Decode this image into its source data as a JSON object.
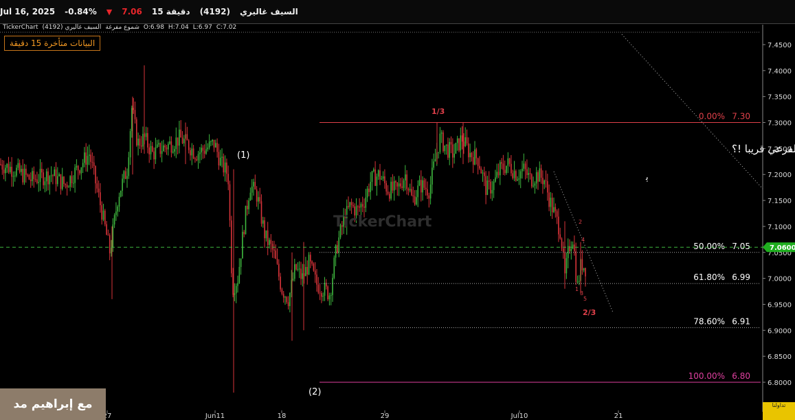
{
  "header": {
    "symbol_name": "السيف غاليري",
    "symbol_code": "(4192)",
    "interval": "15 دقيقة",
    "price": "7.06",
    "change_pct": "-0.84%",
    "date": "Jul 16, 2025"
  },
  "infobar": {
    "brand": "TickerChart",
    "symbol": "السيف غاليري (4192)",
    "chart_kind": "شموع مفرغة",
    "open": "O:6.98",
    "high": "H:7.04",
    "low": "L:6.97",
    "close": "C:7.02"
  },
  "delay_notice": "البيانات متأخرة 15 دقيقة",
  "watermark_text": "TickerChart",
  "author_tag": "مع إبراهيم مد",
  "corner_logo_text": "تداولنا",
  "annotations": {
    "question": "هل سيخترق الترند الفرعي قريبا   !؟",
    "wave_1": "(1)",
    "wave_2": "(2)",
    "top_label": "1/3",
    "bottom_label": "2/3",
    "small_2": "2",
    "small_4": "4",
    "small_1": "1",
    "small_3": "3",
    "small_5": "5",
    "glyph": "ﯦ"
  },
  "colors": {
    "up": "#3fb83f",
    "down": "#d9343a",
    "grid_line": "#555555",
    "fib_red": "#e0404a",
    "fib_pink": "#e040a0",
    "current_price_bg": "#1fae1f"
  },
  "chart_data": {
    "type": "candlestick",
    "y_axis": {
      "min": 6.8,
      "max": 7.45,
      "ticks": [
        "7.4500",
        "7.4000",
        "7.3500",
        "7.3000",
        "7.2500",
        "7.2000",
        "7.1500",
        "7.1000",
        "7.0500",
        "7.0000",
        "6.9500",
        "6.9000",
        "6.8500",
        "6.8000"
      ]
    },
    "x_ticks": [
      "27",
      "Jun11",
      "18",
      "29",
      "Jul10",
      "21"
    ],
    "current_price": "7.0600",
    "fibonacci": [
      {
        "pct": "0.00%",
        "value": "7.30",
        "level": 7.3
      },
      {
        "pct": "50.00%",
        "value": "7.05",
        "level": 7.05
      },
      {
        "pct": "61.80%",
        "value": "6.99",
        "level": 6.99
      },
      {
        "pct": "78.60%",
        "value": "6.91",
        "level": 6.905
      },
      {
        "pct": "100.00%",
        "value": "6.80",
        "level": 6.8
      }
    ],
    "price_path": [
      [
        0,
        7.22
      ],
      [
        20,
        7.21
      ],
      [
        45,
        7.19
      ],
      [
        75,
        7.2
      ],
      [
        95,
        7.18
      ],
      [
        112,
        7.21
      ],
      [
        130,
        7.24
      ],
      [
        148,
        7.13
      ],
      [
        160,
        7.05
      ],
      [
        172,
        7.16
      ],
      [
        185,
        7.21
      ],
      [
        192,
        7.33
      ],
      [
        200,
        7.26
      ],
      [
        210,
        7.27
      ],
      [
        222,
        7.24
      ],
      [
        235,
        7.25
      ],
      [
        250,
        7.26
      ],
      [
        262,
        7.27
      ],
      [
        272,
        7.26
      ],
      [
        285,
        7.24
      ],
      [
        300,
        7.25
      ],
      [
        312,
        7.26
      ],
      [
        322,
        7.22
      ],
      [
        332,
        7.2
      ],
      [
        338,
        6.98
      ],
      [
        346,
        7.0
      ],
      [
        355,
        7.1
      ],
      [
        364,
        7.18
      ],
      [
        374,
        7.16
      ],
      [
        386,
        7.08
      ],
      [
        398,
        7.05
      ],
      [
        410,
        6.98
      ],
      [
        420,
        6.96
      ],
      [
        430,
        7.02
      ],
      [
        440,
        7.0
      ],
      [
        450,
        7.03
      ],
      [
        460,
        6.99
      ],
      [
        470,
        6.98
      ],
      [
        480,
        6.97
      ],
      [
        490,
        7.06
      ],
      [
        500,
        7.11
      ],
      [
        510,
        7.14
      ],
      [
        520,
        7.13
      ],
      [
        530,
        7.15
      ],
      [
        540,
        7.19
      ],
      [
        552,
        7.2
      ],
      [
        565,
        7.17
      ],
      [
        578,
        7.17
      ],
      [
        590,
        7.2
      ],
      [
        600,
        7.15
      ],
      [
        612,
        7.18
      ],
      [
        625,
        7.17
      ],
      [
        632,
        7.22
      ],
      [
        640,
        7.27
      ],
      [
        650,
        7.25
      ],
      [
        660,
        7.24
      ],
      [
        672,
        7.27
      ],
      [
        684,
        7.24
      ],
      [
        696,
        7.23
      ],
      [
        708,
        7.17
      ],
      [
        718,
        7.18
      ],
      [
        728,
        7.21
      ],
      [
        740,
        7.22
      ],
      [
        752,
        7.2
      ],
      [
        762,
        7.21
      ],
      [
        772,
        7.19
      ],
      [
        782,
        7.2
      ],
      [
        792,
        7.19
      ],
      [
        800,
        7.15
      ],
      [
        808,
        7.12
      ],
      [
        816,
        7.09
      ],
      [
        822,
        7.0
      ],
      [
        828,
        7.06
      ],
      [
        834,
        7.08
      ],
      [
        840,
        6.98
      ],
      [
        846,
        7.03
      ],
      [
        852,
        7.02
      ]
    ],
    "spikes": [
      [
        193,
        7.35,
        7.2
      ],
      [
        210,
        7.41,
        7.24
      ],
      [
        163,
        7.1,
        6.96
      ],
      [
        340,
        7.21,
        6.78
      ],
      [
        425,
        7.05,
        6.88
      ],
      [
        442,
        7.07,
        6.9
      ],
      [
        636,
        7.3,
        7.22
      ],
      [
        674,
        7.3,
        7.22
      ],
      [
        822,
        7.11,
        6.98
      ],
      [
        845,
        7.07,
        6.97
      ],
      [
        270,
        7.3,
        7.22
      ]
    ]
  }
}
